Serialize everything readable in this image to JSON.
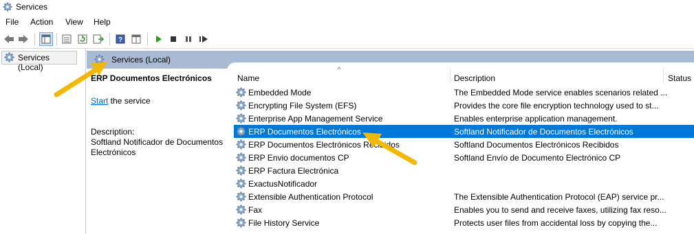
{
  "window": {
    "title": "Services"
  },
  "menu": [
    "File",
    "Action",
    "View",
    "Help"
  ],
  "toolbar": {
    "icons": [
      "back-icon",
      "forward-icon",
      "show-hide-tree-icon",
      "properties-icon",
      "refresh-icon",
      "export-icon",
      "help-icon",
      "view-icon",
      "start-icon",
      "stop-icon",
      "pause-icon",
      "restart-icon"
    ]
  },
  "tree": {
    "item": "Services (Local)"
  },
  "header": {
    "title": "Services (Local)"
  },
  "detail": {
    "service_name": "ERP Documentos Electrónicos",
    "start_link": "Start",
    "start_suffix": " the service",
    "description_label": "Description:",
    "description_text": "Softland Notificador de Documentos Electrónicos"
  },
  "columns": {
    "name": "Name",
    "description": "Description",
    "status": "Status"
  },
  "rows": [
    {
      "name": "Embedded Mode",
      "description": "The Embedded Mode service enables scenarios related ..."
    },
    {
      "name": "Encrypting File System (EFS)",
      "description": "Provides the core file encryption technology used to st..."
    },
    {
      "name": "Enterprise App Management Service",
      "description": "Enables enterprise application management."
    },
    {
      "name": "ERP Documentos Electrónicos",
      "description": "Softland Notificador de Documentos Electrónicos",
      "selected": true
    },
    {
      "name": "ERP Documentos Electrónicos Recibidos",
      "description": "Softland  Documentos Electrónicos Recibidos"
    },
    {
      "name": "ERP Envio documentos CP",
      "description": "Softland Envío de Documento Electrónico CP"
    },
    {
      "name": "ERP Factura Electrónica",
      "description": ""
    },
    {
      "name": "ExactusNotificador",
      "description": ""
    },
    {
      "name": "Extensible Authentication Protocol",
      "description": "The Extensible Authentication Protocol (EAP) service pr..."
    },
    {
      "name": "Fax",
      "description": "Enables you to send and receive faxes, utilizing fax reso..."
    },
    {
      "name": "File History Service",
      "description": "Protects user files from accidental loss by copying the..."
    }
  ],
  "colors": {
    "selection": "#0078d7",
    "header": "#a9bbd4",
    "annotation_arrow": "#f5b800"
  }
}
